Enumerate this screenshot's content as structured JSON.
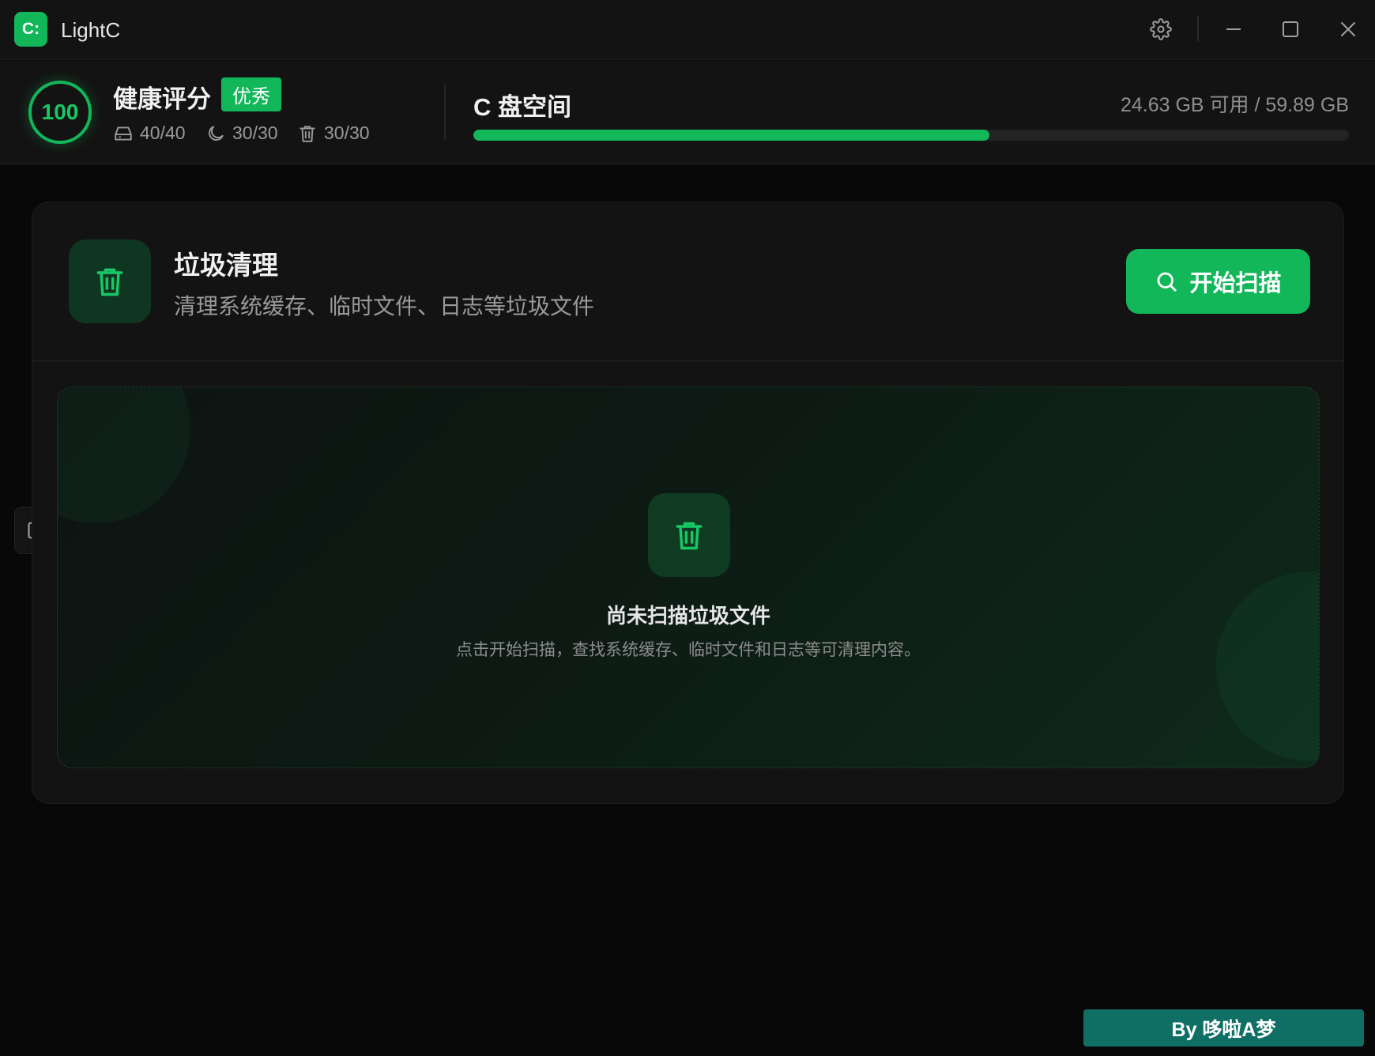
{
  "app": {
    "logo_text": "C:",
    "title": "LightC"
  },
  "window_controls": {
    "settings_icon": "gear-icon",
    "minimize_icon": "minimize-icon",
    "maximize_icon": "maximize-icon",
    "close_icon": "close-icon"
  },
  "health": {
    "score": "100",
    "title": "健康评分",
    "badge": "优秀",
    "metrics": [
      {
        "icon": "drive-icon",
        "value": "40/40"
      },
      {
        "icon": "moon-icon",
        "value": "30/30"
      },
      {
        "icon": "trash-icon",
        "value": "30/30"
      }
    ]
  },
  "disk": {
    "title": "C 盘空间",
    "usage_text": "24.63 GB 可用 / 59.89 GB",
    "used_fraction": 0.589
  },
  "cleanup": {
    "icon": "trash-icon",
    "title": "垃圾清理",
    "subtitle": "清理系统缓存、临时文件、日志等垃圾文件",
    "scan_button": {
      "icon": "search-icon",
      "label": "开始扫描"
    },
    "empty_state": {
      "icon": "trash-icon",
      "title": "尚未扫描垃圾文件",
      "description": "点击开始扫描，查找系统缓存、临时文件和日志等可清理内容。"
    }
  },
  "sidebar_toggle": {
    "icon": "sidebar-panel-icon"
  },
  "credit": "By 哆啦A梦",
  "colors": {
    "accent": "#12b75a",
    "background": "#080808",
    "surface": "#131313",
    "credit_bg": "#0f6f65"
  }
}
